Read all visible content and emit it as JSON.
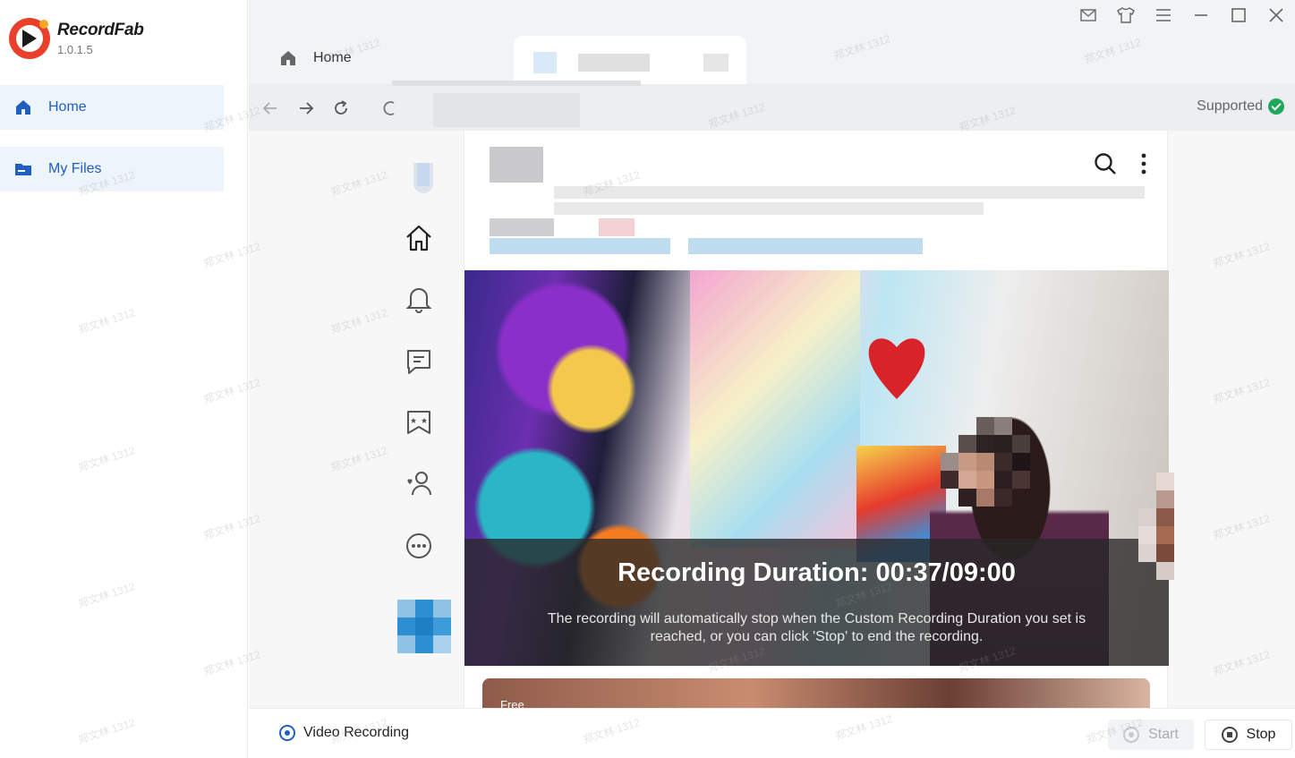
{
  "app": {
    "name": "RecordFab",
    "version": "1.0.1.5"
  },
  "sidebar": {
    "items": [
      {
        "label": "Home",
        "icon": "home-icon"
      },
      {
        "label": "My Files",
        "icon": "folder-icon"
      }
    ]
  },
  "titlebar": {
    "tab_home_label": "Home",
    "window_controls": [
      "mail-icon",
      "shirt-icon",
      "menu-icon",
      "minimize-icon",
      "maximize-icon",
      "close-icon"
    ]
  },
  "browser": {
    "supported_label": "Supported"
  },
  "recording": {
    "title": "Recording Duration: 00:37/09:00",
    "description": "The recording will automatically stop when the Custom Recording Duration you set is reached, or you can click 'Stop' to end the recording."
  },
  "content": {
    "card_badge": "Free"
  },
  "bottombar": {
    "mode_label": "Video Recording",
    "start_label": "Start",
    "stop_label": "Stop"
  },
  "watermark": "郑文林 1312",
  "colors": {
    "accent": "#1f5fbf",
    "brand_red": "#e8402a",
    "supported_green": "#1fa85a"
  }
}
